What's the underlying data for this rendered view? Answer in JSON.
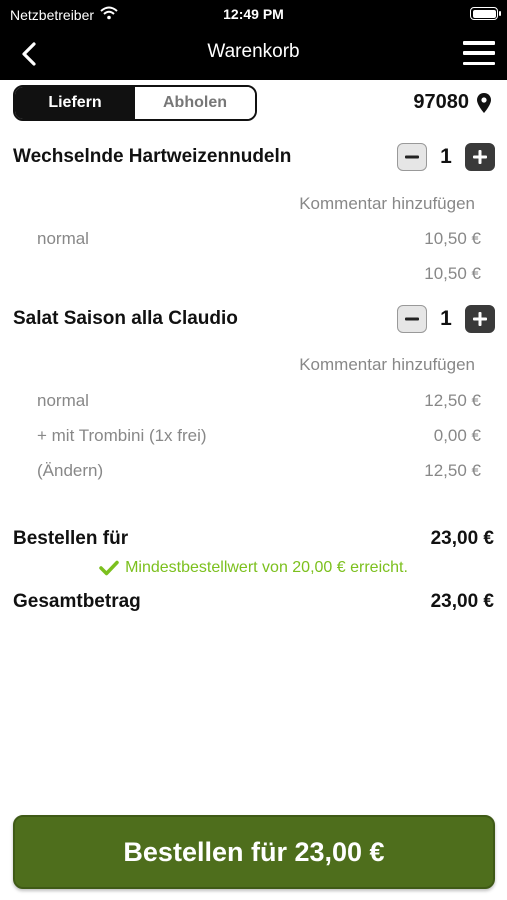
{
  "status_bar": {
    "carrier": "Netzbetreiber",
    "time": "12:49 PM"
  },
  "nav": {
    "title": "Warenkorb"
  },
  "mode": {
    "options": [
      "Liefern",
      "Abholen"
    ],
    "selected": "Liefern"
  },
  "location": {
    "zip": "97080"
  },
  "items": [
    {
      "name": "Wechselnde Hartweizennudeln",
      "quantity": "1",
      "comment_label": "Kommentar hinzufügen",
      "lines": [
        {
          "label": "normal",
          "price": "10,50 €"
        },
        {
          "label": "",
          "price": "10,50 €"
        }
      ]
    },
    {
      "name": "Salat Saison alla Claudio",
      "quantity": "1",
      "comment_label": "Kommentar hinzufügen",
      "lines": [
        {
          "label": "normal",
          "price": "12,50 €"
        },
        {
          "label": "+ mit Trombini (1x frei)",
          "price": "0,00 €"
        },
        {
          "label": "(Ändern)",
          "price": "12,50 €"
        }
      ]
    }
  ],
  "totals": {
    "order_label": "Bestellen für",
    "order_value": "23,00 €",
    "min_order_msg": "Mindestbestellwert von 20,00 € erreicht.",
    "total_label": "Gesamtbetrag",
    "total_value": "23,00 €"
  },
  "order_button": {
    "label": "Bestellen für 23,00 €"
  },
  "colors": {
    "accent_green": "#4e6e1c",
    "success_green": "#7cc01e",
    "topbar": "#000000"
  }
}
